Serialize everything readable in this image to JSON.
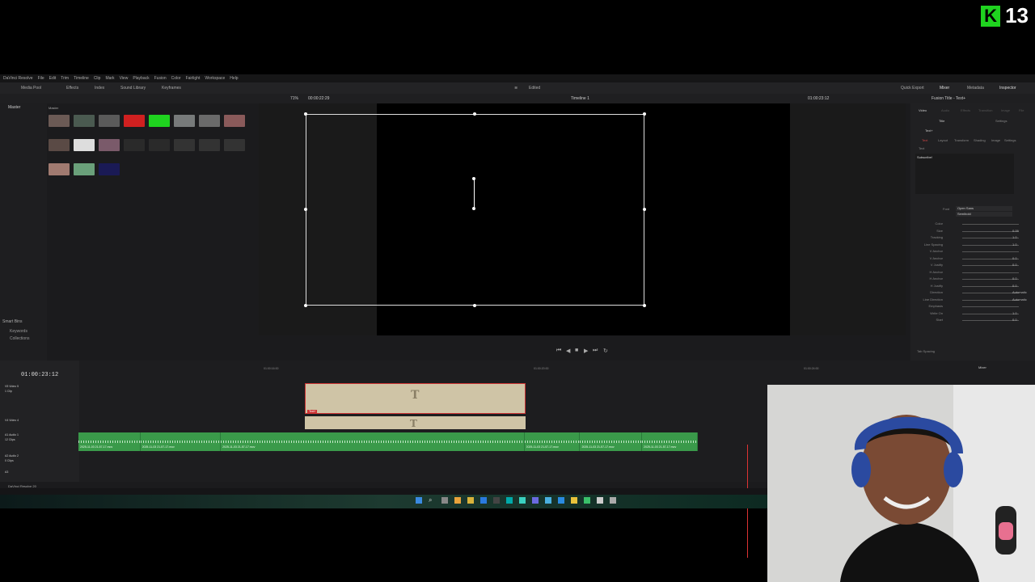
{
  "badge": {
    "letter": "K",
    "number": "13",
    "accent": "#1fd31f"
  },
  "menubar": {
    "items": [
      "DaVinci Resolve",
      "File",
      "Edit",
      "Trim",
      "Timeline",
      "Clip",
      "Mark",
      "View",
      "Playback",
      "Fusion",
      "Color",
      "Fairlight",
      "Workspace",
      "Help"
    ]
  },
  "toolbar": {
    "media_pool": "Media Pool",
    "effects": "Effects",
    "index": "Index",
    "sound_library": "Sound Library",
    "keyframes": "Keyframes",
    "project_status": "Edited",
    "quick_export": "Quick Export",
    "mixer": "Mixer",
    "metadata": "Metadata",
    "inspector": "Inspector"
  },
  "viewer_bar": {
    "zoom": "71%",
    "source_timecode": "00:00:22:29",
    "timeline_name": "Timeline 1",
    "record_timecode": "01:00:23:12"
  },
  "media_pool": {
    "left_header": "Master",
    "bin_header": "Master",
    "smart_bins": "Smart Bins",
    "smart_items": [
      "Keywords",
      "Collections"
    ],
    "clips": [
      {
        "label": "",
        "color": "#6b5a55"
      },
      {
        "label": "",
        "color": "#4a5a50"
      },
      {
        "label": "",
        "color": "#5a5a5a"
      },
      {
        "label": "",
        "color": "#d02020"
      },
      {
        "label": "",
        "color": "#1fd31f"
      },
      {
        "label": "",
        "color": "#777a7a"
      },
      {
        "label": "",
        "color": "#6a6a6a"
      },
      {
        "label": "",
        "color": "#8a5a5a"
      },
      {
        "label": "",
        "color": "#5a4a45"
      },
      {
        "label": "",
        "color": "#ddd"
      },
      {
        "label": "",
        "color": "#7a5a6a"
      },
      {
        "label": "",
        "color": "#2a2a2a"
      },
      {
        "label": "",
        "color": "#2a2a2a"
      },
      {
        "label": "",
        "color": "#333"
      },
      {
        "label": "",
        "color": "#333"
      },
      {
        "label": "",
        "color": "#333"
      },
      {
        "label": "",
        "color": "#a07a70"
      },
      {
        "label": "",
        "color": "#6aa07a"
      },
      {
        "label": "",
        "color": "#1a1a55"
      }
    ]
  },
  "inspector": {
    "title": "Fusion Title - Text+",
    "tabs": [
      "Video",
      "Audio",
      "Effects",
      "Transition",
      "Image",
      "File"
    ],
    "subtabs": [
      "Title",
      "Settings"
    ],
    "section": "Text+",
    "text_tabs": [
      "Text",
      "Layout",
      "Transform",
      "Shading",
      "Image",
      "Settings"
    ],
    "text_section": "Text",
    "text_value": "Subscribe!",
    "font_label": "Font",
    "font_value": "Open Sans",
    "style_value": "Semibold",
    "rows": [
      {
        "label": "Color",
        "value": ""
      },
      {
        "label": "Size",
        "value": "0.09"
      },
      {
        "label": "Tracking",
        "value": "1.0"
      },
      {
        "label": "Line Spacing",
        "value": "1.0"
      },
      {
        "label": "V Anchor",
        "value": ""
      },
      {
        "label": "V Anchor",
        "value": "0.0"
      },
      {
        "label": "V Justify",
        "value": "0.0"
      },
      {
        "label": "H Anchor",
        "value": ""
      },
      {
        "label": "H Anchor",
        "value": "0.0"
      },
      {
        "label": "H Justify",
        "value": "0.0"
      },
      {
        "label": "Direction",
        "value": "Automatic"
      },
      {
        "label": "Line Direction",
        "value": "Automatic"
      },
      {
        "label": "Emphasis",
        "value": ""
      },
      {
        "label": "Write On",
        "value": "1.0"
      },
      {
        "label": "Start",
        "value": "0.0"
      }
    ],
    "tab_spacing": "Tab Spacing"
  },
  "timeline": {
    "timecode": "01:00:23:12",
    "ruler": [
      "01:00:16:00",
      "01:00:20:00",
      "01:00:24:00"
    ],
    "tracks": [
      {
        "id": "V5",
        "name": "Video 5",
        "clips": "1 Clip"
      },
      {
        "id": "V4",
        "name": "Video 4",
        "clips": ""
      },
      {
        "id": "A1",
        "name": "Audio 1",
        "clips": "12 Clips"
      },
      {
        "id": "A2",
        "name": "Audio 2",
        "clips": "0 Clips"
      },
      {
        "id": "A3",
        "name": "",
        "clips": ""
      }
    ],
    "title_clip_glyph": "T",
    "title_clip_label": "Text+",
    "audio_clips": [
      {
        "label": "2025-11-03 21-57-17.mov",
        "width_share": 10
      },
      {
        "label": "2025-11-03 21-57-17.mov",
        "width_share": 13
      },
      {
        "label": "2025-11-03 21-57-17.mov",
        "width_share": 49
      },
      {
        "label": "2025-11-03 21-57-17.mov",
        "width_share": 9
      },
      {
        "label": "2025-11-03 21-57-17.mov",
        "width_share": 10
      },
      {
        "label": "2025-11-03 21-57-17.mov",
        "width_share": 9
      }
    ],
    "mixer_label": "Mixer"
  },
  "bottom": {
    "app_name": "DaVinci Resolve 20"
  }
}
